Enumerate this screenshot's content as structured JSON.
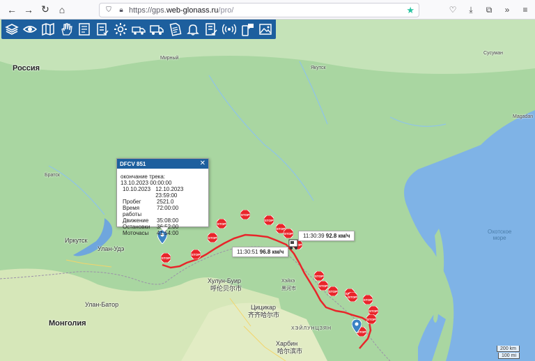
{
  "browser": {
    "url_prefix": "https://gps.",
    "url_host": "web-glonass.ru",
    "url_path": "/pro/"
  },
  "toolbar": {
    "icons": [
      "layers-icon",
      "eye-icon",
      "map-icon",
      "hand-icon",
      "report-icon",
      "checklist-icon",
      "gear-icon",
      "truck-gear-icon",
      "truck-icon",
      "document-icon",
      "bell-icon",
      "checklist-edit-icon",
      "signal-icon",
      "phone-message-icon",
      "picture-icon"
    ]
  },
  "map": {
    "labels": {
      "russia": "Россия",
      "mongolia": "Монголия",
      "irkutsk": "Иркутск",
      "ulan_ude": "Улан-Удэ",
      "ulan_bator": "Улан-Батор",
      "bratsk": "Братск",
      "mirny": "Мирный",
      "yakutsk": "Якутск",
      "susuman": "Сусуман",
      "magadan": "Magadan",
      "hulunbuir": "Хулун-Буир",
      "hulunbuir_cn": "呼伦贝尔市",
      "qiqihar": "Цицикар",
      "qiqihar_cn": "齐齐哈尔市",
      "heilongjiang": "ХЭЙЛУНЦЗЯН",
      "harbin": "Харбин",
      "harbin_cn": "哈尔滨市",
      "heihe": "Хэйхэ",
      "heihe_cn": "黑河市",
      "okhotsk_sea": "Охотское\nморе"
    },
    "stop_label": "STOP",
    "scale_km": "200 km",
    "scale_mi": "100 mi"
  },
  "popup": {
    "title": "DFCV 851",
    "close": "✕",
    "track_end_label": "окончание трека:",
    "track_end_value": "13.10.2023 00:00:00",
    "period_from": "10.10.2023",
    "period_to": "12.10.2023 23:59:00",
    "rows": [
      {
        "label": "Пробег",
        "value": "2521.0"
      },
      {
        "label": "Время работы",
        "value": "72:00:00"
      },
      {
        "label": "Движение",
        "value": "35:08:00"
      },
      {
        "label": "Остановки",
        "value": "36:52:00"
      },
      {
        "label": "Моточасы",
        "value": "41:54:00"
      }
    ]
  },
  "speed_tags": [
    {
      "time": "11:30:39",
      "speed": "92.8 км/ч"
    },
    {
      "time": "11:30:51",
      "speed": "96.8 км/ч"
    }
  ],
  "colors": {
    "toolbar": "#1d5f9e",
    "track": "#e8252a",
    "land": "#a8d5a2",
    "water": "#7fb3e6"
  }
}
